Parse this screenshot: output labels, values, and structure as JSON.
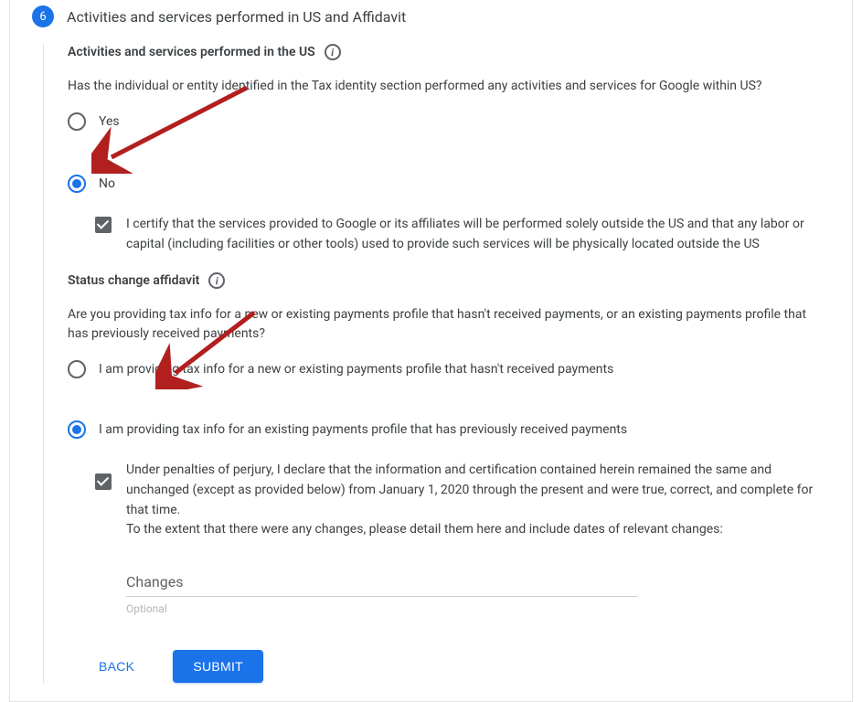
{
  "step": {
    "number": "6",
    "title": "Activities and services performed in US and Affidavit"
  },
  "section1": {
    "heading": "Activities and services performed in the US",
    "question": "Has the individual or entity identified in the Tax identity section performed any activities and services for Google within US?",
    "options": {
      "yes": "Yes",
      "no": "No"
    },
    "cert": "I certify that the services provided to Google or its affiliates will be performed solely outside the US and that any labor or capital (including facilities or other tools) used to provide such services will be physically located outside the US"
  },
  "section2": {
    "heading": "Status change affidavit",
    "question": "Are you providing tax info for a new or existing payments profile that hasn't received payments, or an existing payments profile that has previously received payments?",
    "options": {
      "new": "I am providing tax info for a new or existing payments profile that hasn't received payments",
      "existing": "I am providing tax info for an existing payments profile that has previously received payments"
    },
    "decl": "Under penalties of perjury, I declare that the information and certification contained herein remained the same and unchanged (except as provided below) from January 1, 2020 through the present and were true, correct, and complete for that time.\nTo the extent that there were any changes, please detail them here and include dates of relevant changes:"
  },
  "field": {
    "label": "Changes",
    "hint": "Optional"
  },
  "buttons": {
    "back": "BACK",
    "submit": "SUBMIT"
  }
}
